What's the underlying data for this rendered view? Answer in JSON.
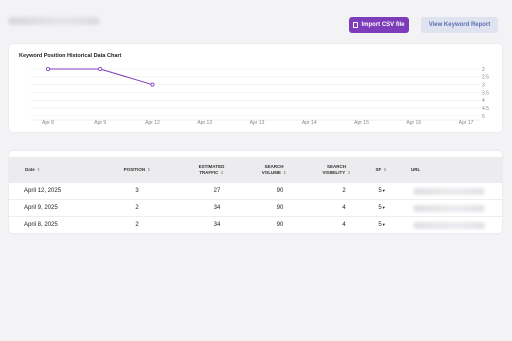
{
  "header": {
    "import_button": "Import CSV file",
    "report_button": "View Keyword Report"
  },
  "chart": {
    "title": "Keyword Position Historical Data Chart"
  },
  "chart_data": {
    "type": "line",
    "title": "Keyword Position Historical Data Chart",
    "categories": [
      "Apr 8",
      "Apr 9",
      "Apr 12",
      "Apr 12",
      "Apr 13",
      "Apr 14",
      "Apr 15",
      "Apr 16",
      "Apr 17"
    ],
    "series": [
      {
        "values": [
          2,
          2,
          3
        ]
      }
    ],
    "y_ticks": [
      "2",
      "2.5",
      "3",
      "3.5",
      "4",
      "4.5",
      "5"
    ],
    "ylim": [
      2,
      5
    ],
    "y_inverted": true,
    "y_axis_side": "right",
    "grid": true,
    "color": "#7d3cb9"
  },
  "table": {
    "columns": [
      "Date",
      "POSITION",
      "ESTIMATED TRAFFIC",
      "SEARCH VOLUME",
      "SEARCH VISIBILITY",
      "SF",
      "URL"
    ],
    "rows": [
      {
        "date": "April 12, 2025",
        "position": "3",
        "traffic": "27",
        "volume": "90",
        "visibility": "2",
        "sf": "5"
      },
      {
        "date": "April 9, 2025",
        "position": "2",
        "traffic": "34",
        "volume": "90",
        "visibility": "4",
        "sf": "5"
      },
      {
        "date": "April 8, 2025",
        "position": "2",
        "traffic": "34",
        "volume": "90",
        "visibility": "4",
        "sf": "5"
      }
    ]
  }
}
